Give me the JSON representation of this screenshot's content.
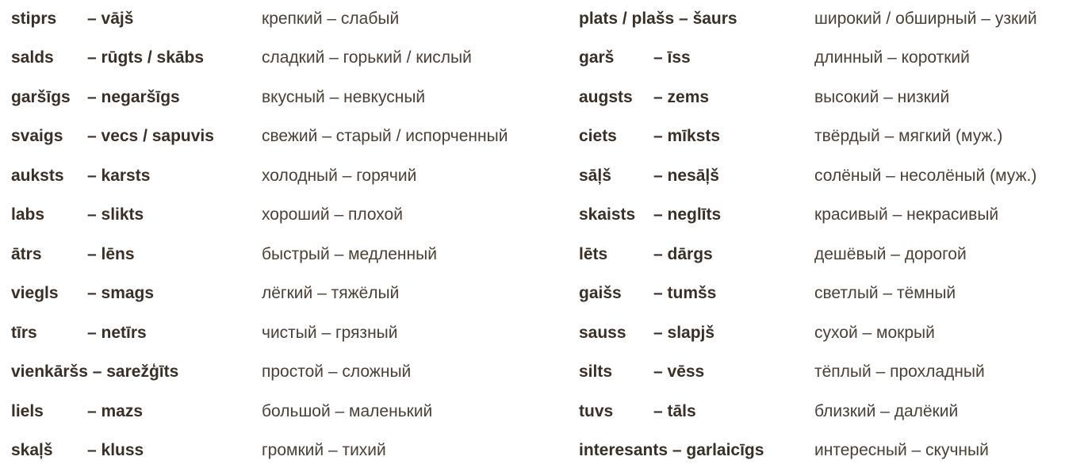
{
  "rows": [
    {
      "lv1": "stiprs",
      "lv1b": "– vājš",
      "ru1": "крепкий  – слабый",
      "lv2": "plats / plašs – šaurs",
      "lv2b": "",
      "ru2": "широкий / обширный – узкий"
    },
    {
      "lv1": "salds",
      "lv1b": "– rūgts / skābs",
      "ru1": "сладкий  – горький / кислый",
      "lv2": "garš",
      "lv2b": "– īss",
      "ru2": "длинный – короткий"
    },
    {
      "lv1": "garšīgs",
      "lv1b": "– negaršīgs",
      "ru1": "вкусный  – невкусный",
      "lv2": "augsts",
      "lv2b": "– zems",
      "ru2": "высокий  – низкий"
    },
    {
      "lv1": "svaigs",
      "lv1b": "– vecs / sapuvis",
      "ru1": "свежий    – старый / испорченный",
      "lv2": "ciets",
      "lv2b": "– mīksts",
      "ru2": "твёрдый – мягкий (муж.)"
    },
    {
      "lv1": "auksts",
      "lv1b": "– karsts",
      "ru1": "холодный – горячий",
      "lv2": "sāļš",
      "lv2b": "– nesāļš",
      "ru2": "солёный – несолёный (муж.)"
    },
    {
      "lv1": "labs",
      "lv1b": "– slikts",
      "ru1": "хороший – плохой",
      "lv2": "skaists",
      "lv2b": "– neglīts",
      "ru2": "красивый – некрасивый"
    },
    {
      "lv1": "ātrs",
      "lv1b": "– lēns",
      "ru1": "быстрый – медленный",
      "lv2": "lēts",
      "lv2b": "– dārgs",
      "ru2": "дешёвый – дорогой"
    },
    {
      "lv1": "viegls",
      "lv1b": "– smags",
      "ru1": "лёгкий     – тяжёлый",
      "lv2": "gaišs",
      "lv2b": "– tumšs",
      "ru2": "светлый  – тёмный"
    },
    {
      "lv1": "tīrs",
      "lv1b": "– netīrs",
      "ru1": "чистый     – грязный",
      "lv2": "sauss",
      "lv2b": "– slapjš",
      "ru2": "сухой       – мокрый"
    },
    {
      "lv1": "vienkāršs – sarežģīts",
      "lv1b": "",
      "ru1": "простой   – сложный",
      "lv2": "silts",
      "lv2b": "– vēss",
      "ru2": "тёплый     – прохладный"
    },
    {
      "lv1": "liels",
      "lv1b": "– mazs",
      "ru1": "большой – маленький",
      "lv2": "tuvs",
      "lv2b": "– tāls",
      "ru2": "близкий   – далёкий"
    },
    {
      "lv1": "skaļš",
      "lv1b": "– kluss",
      "ru1": "громкий   – тихий",
      "lv2": "interesants – garlaicīgs",
      "lv2b": "",
      "ru2": "интересный – скучный"
    }
  ]
}
